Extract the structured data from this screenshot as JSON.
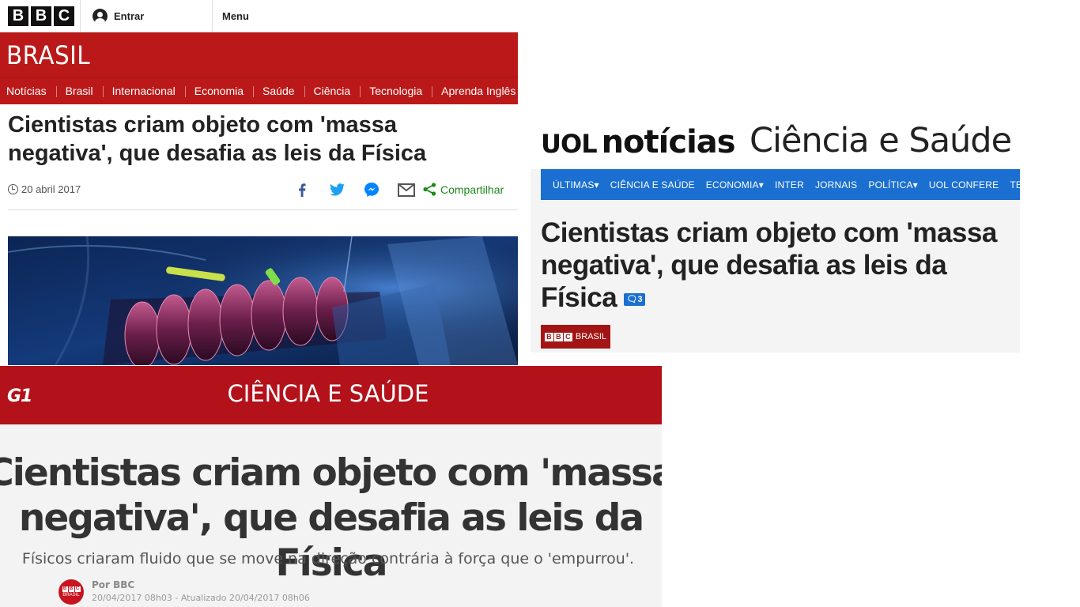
{
  "bbc": {
    "logo_letters": [
      "B",
      "B",
      "C"
    ],
    "signin_label": "Entrar",
    "menu_label": "Menu",
    "brand": "BRASIL",
    "nav": [
      "Notícias",
      "Brasil",
      "Internacional",
      "Economia",
      "Saúde",
      "Ciência",
      "Tecnologia",
      "Aprenda Inglês"
    ],
    "headline": "Cientistas criam objeto com 'massa negativa', que desafia as leis da Física",
    "date": "20 abril 2017",
    "share_label": "Compartilhar",
    "share_icons": [
      "facebook-icon",
      "twitter-icon",
      "messenger-icon",
      "email-icon",
      "share-icon"
    ],
    "colors": {
      "brand_red": "#bb1919",
      "share_green": "#1a8a1a"
    }
  },
  "uol": {
    "logo_brand": "UOL",
    "logo_word": "notícias",
    "section": "Ciência e Saúde",
    "nav": [
      "ÚLTIMAS▾",
      "CIÊNCIA E SAÚDE",
      "ECONOMIA▾",
      "INTER",
      "JORNAIS",
      "POLÍTICA▾",
      "UOL CONFERE",
      "TECNOLOGIA"
    ],
    "headline": "Cientistas criam objeto com 'massa negativa', que desafia as leis da Física",
    "comment_count": "3",
    "source_label": "BRASIL",
    "colors": {
      "nav_blue": "#1a6fd1"
    }
  },
  "g1": {
    "logo": "G1",
    "section": "CIÊNCIA E SAÚDE",
    "headline": "Cientistas criam objeto com 'massa negativa', que desafia as leis da Física",
    "subtitle": "Físicos criaram fluido que se move na direção contrária à força que o 'empurrou'.",
    "author": "Por BBC",
    "avatar_label": "BRASIL",
    "dates": "20/04/2017 08h03 - Atualizado 20/04/2017 08h06",
    "colors": {
      "brand_red": "#b3121b"
    }
  }
}
